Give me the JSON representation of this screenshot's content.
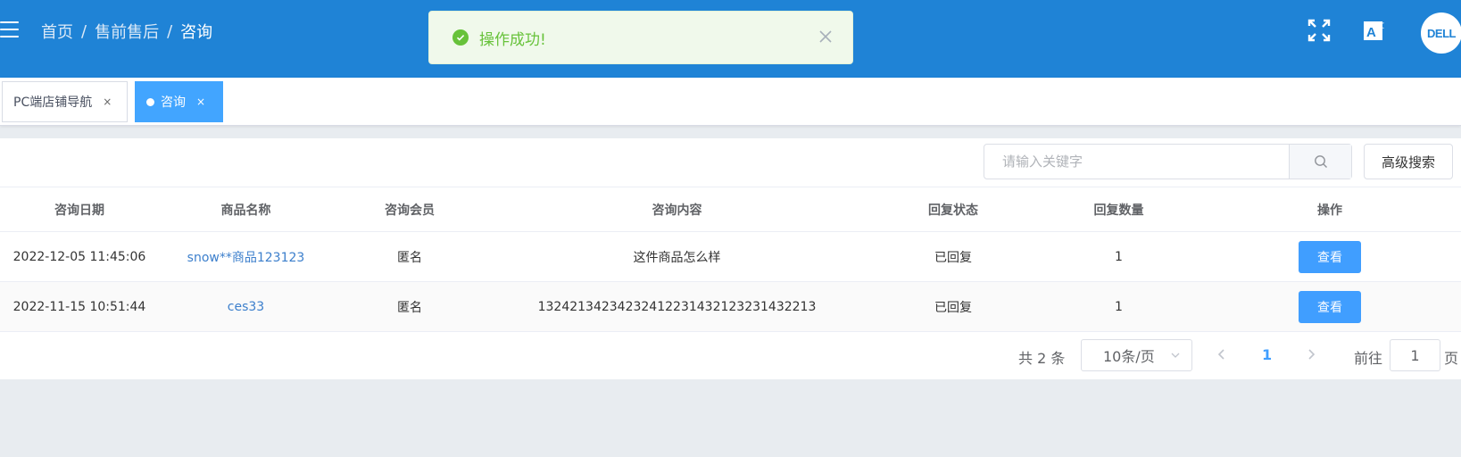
{
  "breadcrumb": {
    "items": [
      "首页",
      "售前售后"
    ],
    "current": "咨询",
    "separator": "/"
  },
  "toast": {
    "message": "操作成功!",
    "type": "success"
  },
  "header_icons": {
    "fullscreen": "fullscreen-icon",
    "translate": "translate-icon",
    "avatar_brand": "DELL"
  },
  "tabs": [
    {
      "label": "PC端店铺导航",
      "close": "×",
      "active": false
    },
    {
      "label": "咨询",
      "close": "×",
      "active": true
    }
  ],
  "search": {
    "placeholder": "请输入关键字",
    "advanced_label": "高级搜索"
  },
  "table": {
    "columns": [
      "咨询日期",
      "商品名称",
      "咨询会员",
      "咨询内容",
      "回复状态",
      "回复数量",
      "操作"
    ],
    "rows": [
      {
        "date": "2022-12-05 11:45:06",
        "product": "snow**商品123123",
        "member": "匿名",
        "content": "这件商品怎么样",
        "status": "已回复",
        "count": "1",
        "action": "查看"
      },
      {
        "date": "2022-11-15 10:51:44",
        "product": "ces33",
        "member": "匿名",
        "content": "1324213423423241223143212323143221​3",
        "status": "已回复",
        "count": "1",
        "action": "查看"
      }
    ]
  },
  "pagination": {
    "total_text": "共 2 条",
    "page_size": "10条/页",
    "current_page": "1",
    "goto_label": "前往",
    "goto_value": "1",
    "page_suffix": "页"
  },
  "colors": {
    "header": "#1f83d6",
    "primary": "#409eff",
    "success": "#67c23a"
  }
}
